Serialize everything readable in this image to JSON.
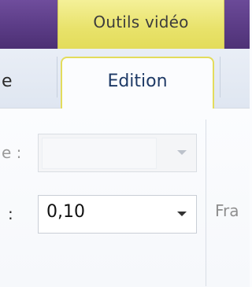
{
  "context_tab": {
    "label": "Outils vidéo"
  },
  "tabs": [
    {
      "label": "e"
    },
    {
      "label": "Edition",
      "active": true
    }
  ],
  "ribbon": {
    "row1": {
      "label": "e :",
      "value": ""
    },
    "row2": {
      "label": ":",
      "value": "0,10"
    },
    "right_text": "Fra"
  },
  "colors": {
    "purple": "#5b3c86",
    "yellow": "#e3dc5b"
  }
}
